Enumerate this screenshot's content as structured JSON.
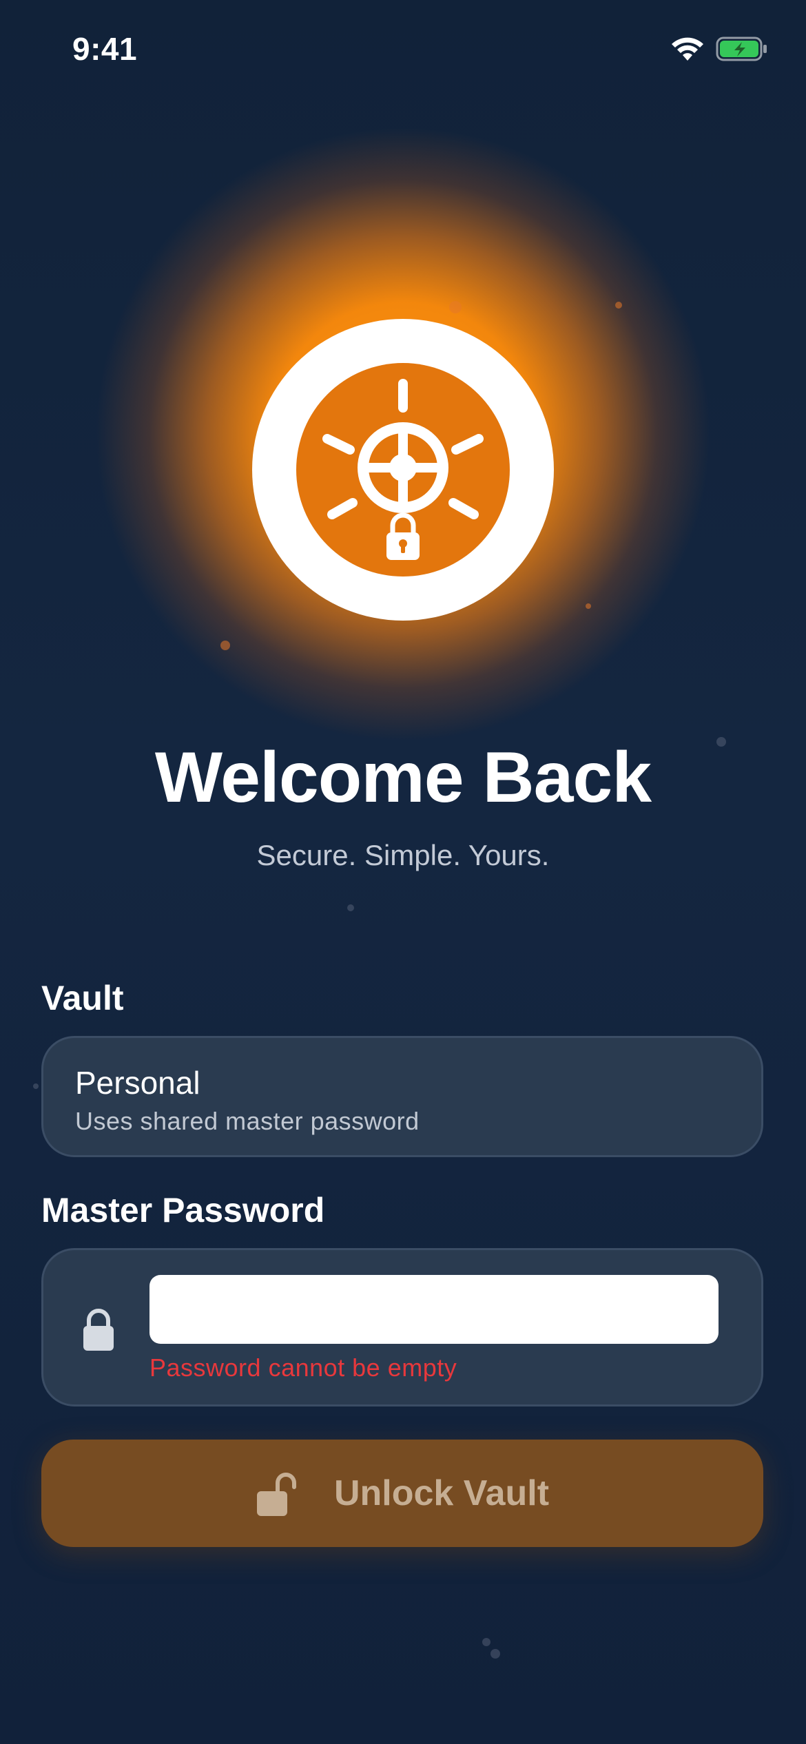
{
  "status_bar": {
    "time": "9:41"
  },
  "header": {
    "title": "Welcome Back",
    "subtitle": "Secure. Simple. Yours."
  },
  "vault": {
    "label": "Vault",
    "selected_name": "Personal",
    "selected_description": "Uses shared master password"
  },
  "password": {
    "label": "Master Password",
    "value": "",
    "error": "Password cannot be empty"
  },
  "unlock_button": {
    "label": "Unlock Vault"
  },
  "icons": {
    "logo": "safe-wheel-lock-icon",
    "field_lock": "lock-icon",
    "button": "unlock-icon",
    "status": [
      "wifi-icon",
      "battery-charging-icon"
    ]
  },
  "colors": {
    "background": "#142640",
    "accent": "#e3760d",
    "error": "#e8383c",
    "button": "#774c22",
    "battery": "#35c759"
  }
}
